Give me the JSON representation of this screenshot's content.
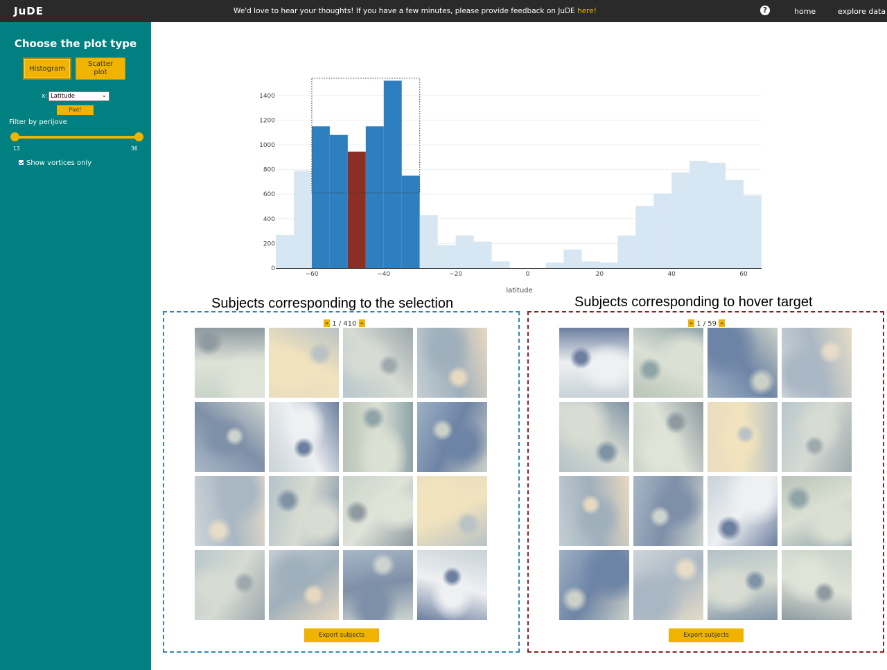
{
  "topbar": {
    "brand": "JuDE",
    "feedback_text": "We'd love to hear your thoughts! If you have a few minutes, please provide feedback on JuDE ",
    "feedback_link": "here!",
    "help_glyph": "?",
    "nav": [
      "home",
      "explore data"
    ]
  },
  "sidebar": {
    "heading": "Choose the plot type",
    "histogram_label": "Histogram",
    "scatter_label_line1": "Scatter",
    "scatter_label_line2": "plot",
    "x_label": "x:",
    "x_selected": "Latitude",
    "plot_button": "Plot!",
    "filter_label": "Filter by perijove",
    "slider": {
      "min": 13,
      "max": 36,
      "low": 13,
      "high": 36
    },
    "slider_min_label": "13",
    "slider_max_label": "36",
    "vortices_label": "Show vortices only",
    "vortices_checked": true
  },
  "chart_data": {
    "type": "bar",
    "xlabel": "latitude",
    "xlim": [
      -70,
      65
    ],
    "ylim": [
      0,
      1500
    ],
    "bin_width": 5,
    "x_ticks": [
      -60,
      -40,
      -20,
      0,
      20,
      40,
      60
    ],
    "y_ticks": [
      0,
      200,
      400,
      600,
      800,
      1000,
      1200,
      1400
    ],
    "bins": [
      {
        "x0": -70,
        "value": 270,
        "state": "unselected"
      },
      {
        "x0": -65,
        "value": 790,
        "state": "unselected"
      },
      {
        "x0": -60,
        "value": 1150,
        "state": "selected"
      },
      {
        "x0": -55,
        "value": 1080,
        "state": "selected"
      },
      {
        "x0": -50,
        "value": 945,
        "state": "hovered"
      },
      {
        "x0": -45,
        "value": 1150,
        "state": "selected"
      },
      {
        "x0": -40,
        "value": 1520,
        "state": "selected"
      },
      {
        "x0": -35,
        "value": 750,
        "state": "selected"
      },
      {
        "x0": -30,
        "value": 430,
        "state": "unselected"
      },
      {
        "x0": -25,
        "value": 185,
        "state": "unselected"
      },
      {
        "x0": -20,
        "value": 265,
        "state": "unselected"
      },
      {
        "x0": -15,
        "value": 215,
        "state": "unselected"
      },
      {
        "x0": -10,
        "value": 55,
        "state": "unselected"
      },
      {
        "x0": -5,
        "value": 0,
        "state": "unselected"
      },
      {
        "x0": 0,
        "value": 0,
        "state": "unselected"
      },
      {
        "x0": 5,
        "value": 45,
        "state": "unselected"
      },
      {
        "x0": 10,
        "value": 150,
        "state": "unselected"
      },
      {
        "x0": 15,
        "value": 55,
        "state": "unselected"
      },
      {
        "x0": 20,
        "value": 45,
        "state": "unselected"
      },
      {
        "x0": 25,
        "value": 265,
        "state": "unselected"
      },
      {
        "x0": 30,
        "value": 505,
        "state": "unselected"
      },
      {
        "x0": 35,
        "value": 605,
        "state": "unselected"
      },
      {
        "x0": 40,
        "value": 775,
        "state": "unselected"
      },
      {
        "x0": 45,
        "value": 870,
        "state": "unselected"
      },
      {
        "x0": 50,
        "value": 855,
        "state": "unselected"
      },
      {
        "x0": 55,
        "value": 715,
        "state": "unselected"
      },
      {
        "x0": 60,
        "value": 590,
        "state": "unselected"
      }
    ],
    "selection_box": {
      "x0": -60,
      "x1": -30,
      "y0": 610,
      "y1": 1540
    },
    "colors": {
      "selected": "#2e7fc0",
      "hovered": "#8b2e26",
      "unselected": "#d6e6f3"
    }
  },
  "panels": [
    {
      "title": "Subjects corresponding to the selection",
      "pager": "1 / 410",
      "export_label": "Export subjects",
      "border_color": "#2e86b4"
    },
    {
      "title": "Subjects corresponding to hover target",
      "pager": "1 / 59",
      "export_label": "Export subjects",
      "border_color": "#8b2020"
    }
  ],
  "pager_prev": "«",
  "pager_next": "»"
}
